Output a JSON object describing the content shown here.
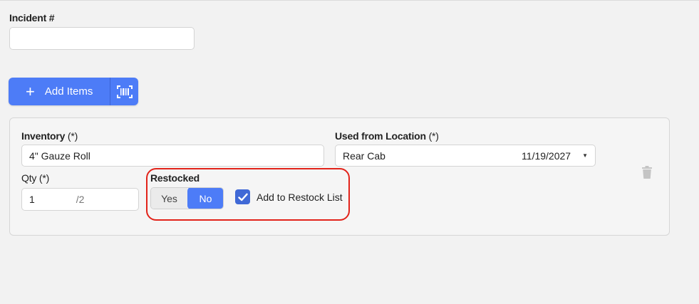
{
  "incident": {
    "label": "Incident #",
    "value": ""
  },
  "add_items": {
    "label": "Add Items",
    "plus": "+",
    "scan_icon": "barcode-scan-icon"
  },
  "item": {
    "inventory": {
      "label": "Inventory",
      "required": "(*)",
      "value": "4\" Gauze Roll"
    },
    "location": {
      "label": "Used from Location",
      "required": "(*)",
      "value": "Rear Cab",
      "date": "11/19/2027"
    },
    "qty": {
      "label": "Qty",
      "required": "(*)",
      "value": "1",
      "max": "/2"
    },
    "restocked": {
      "label": "Restocked",
      "yes": "Yes",
      "no": "No",
      "selected": "No"
    },
    "restock_list": {
      "label": "Add to Restock List",
      "checked": true
    },
    "delete_icon": "trash-icon"
  },
  "colors": {
    "accent": "#4d7cf7",
    "highlight": "#e2231a"
  }
}
